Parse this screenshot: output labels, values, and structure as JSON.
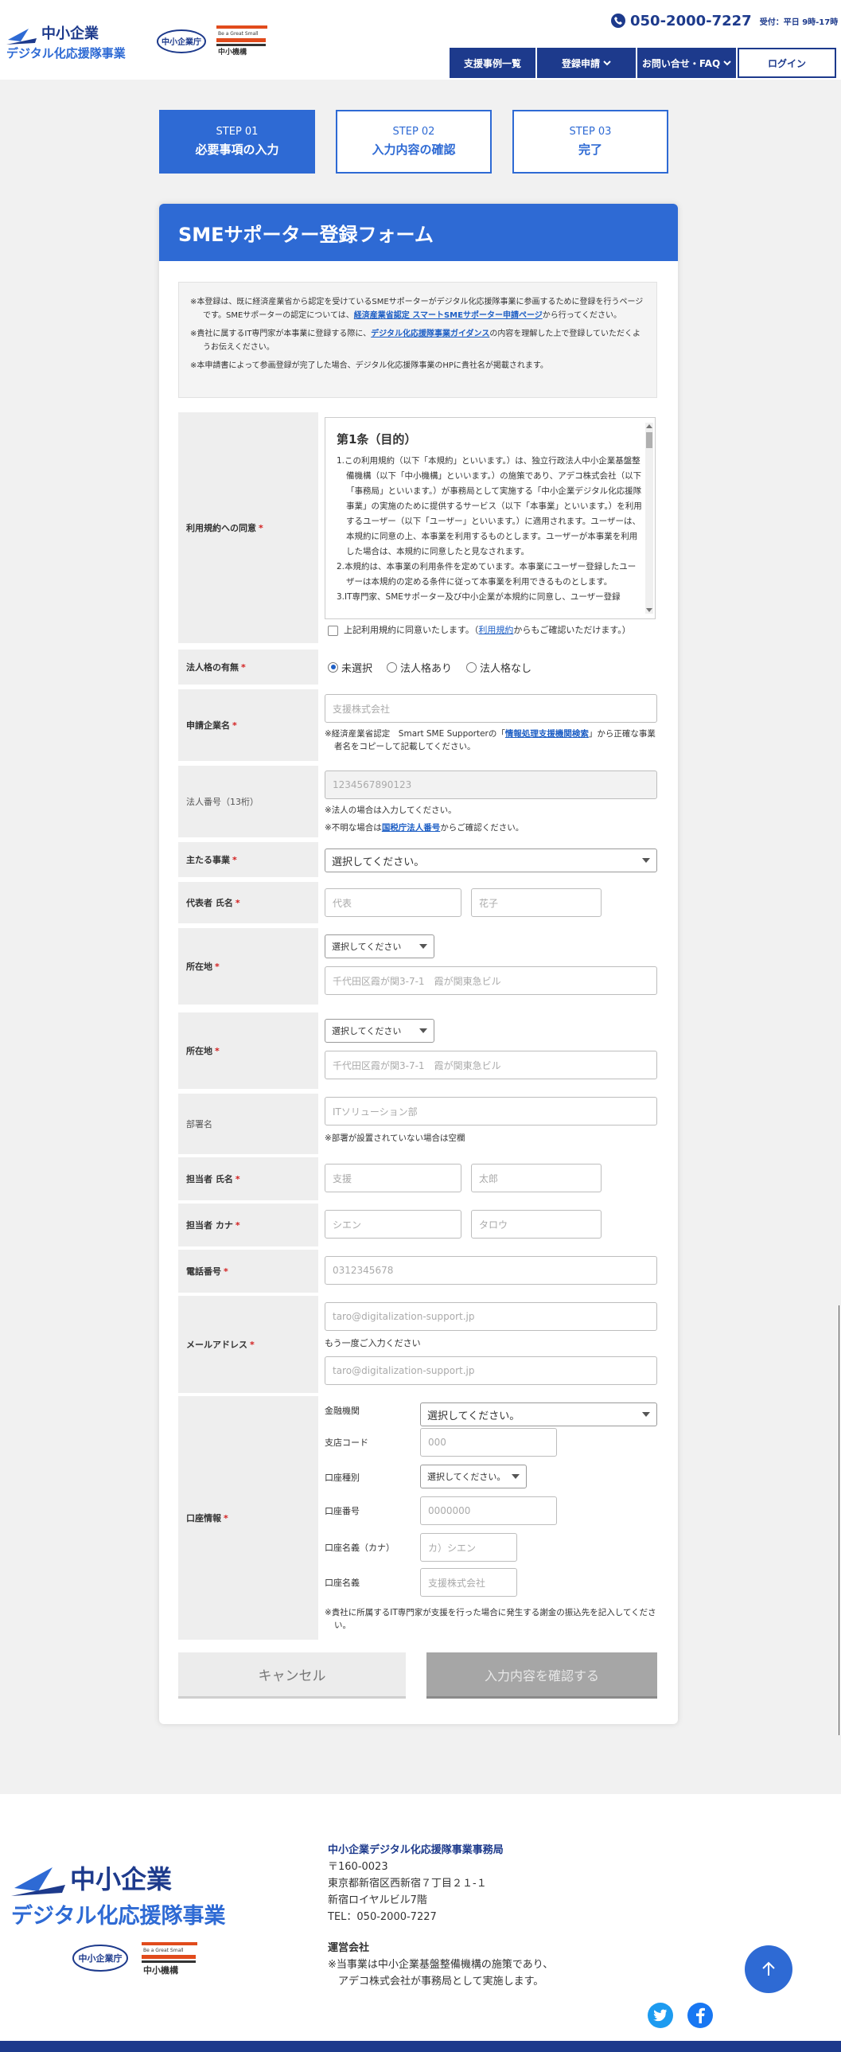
{
  "header": {
    "logo_alt_line1": "中小企業",
    "logo_alt_line2": "デジタル化応援隊事業",
    "phone_number": "050-2000-7227",
    "phone_hours": "受付：平日 9時-17時",
    "nav": [
      {
        "label": "支援事例一覧"
      },
      {
        "label": "登録申請"
      },
      {
        "label": "お問い合せ・FAQ"
      },
      {
        "label": "ログイン"
      }
    ],
    "small_logo_a": "中小企業庁",
    "small_logo_b_top": "Be a Great Small",
    "small_logo_b_bottom": "中小機構"
  },
  "steps": [
    {
      "num": "STEP 01",
      "label": "必要事項の入力"
    },
    {
      "num": "STEP 02",
      "label": "入力内容の確認"
    },
    {
      "num": "STEP 03",
      "label": "完了"
    }
  ],
  "form": {
    "title": "SMEサポーター登録フォーム",
    "notice": {
      "p1_a": "※本登録は、既に経済産業省から認定を受けているSMEサポーターがデジタル化応援隊事業に参画するために登録を行うページです。SMEサポーターの認定については、",
      "p1_link": "経済産業省認定 スマートSMEサポーター申請ページ",
      "p1_b": "から行ってください。",
      "p2_a": "※貴社に属するIT専門家が本事業に登録する際に、",
      "p2_link": "デジタル化応援隊事業ガイダンス",
      "p2_b": "の内容を理解した上で登録していただくようお伝えください。",
      "p3": "※本申請書によって参画登録が完了した場合、デジタル化応援隊事業のHPに貴社名が掲載されます。"
    },
    "required_mark": "*",
    "terms": {
      "label": "利用規約への同意",
      "heading": "第1条（目的）",
      "p1": "1.この利用規約（以下「本規約」といいます。）は、独立行政法人中小企業基盤整備機構（以下「中小機構」といいます。）の施策であり、アデコ株式会社（以下「事務局」といいます。）が事務局として実施する「中小企業デジタル化応援隊事業」の実施のために提供するサービス（以下「本事業」といいます。）を利用するユーザー（以下「ユーザー」といいます。）に適用されます。ユーザーは、本規約に同意の上、本事業を利用するものとします。ユーザーが本事業を利用した場合は、本規約に同意したと見なされます。",
      "p2": "2.本規約は、本事業の利用条件を定めています。本事業にユーザー登録したユーザーは本規約の定める条件に従って本事業を利用できるものとします。",
      "p3": "3.IT専門家、SMEサポーター及び中小企業が本規約に同意し、ユーザー登録",
      "agree_a": "上記利用規約に同意いたします。（",
      "agree_link": "利用規約",
      "agree_b": "からもご確認いただけます。）"
    },
    "corp": {
      "label": "法人格の有無",
      "options": [
        "未選択",
        "法人格あり",
        "法人格なし"
      ],
      "selected": "未選択"
    },
    "company": {
      "label": "申請企業名",
      "placeholder": "支援株式会社",
      "note_a": "※経済産業省認定　Smart SME Supporterの「",
      "note_link": "情報処理支援機関検索",
      "note_b": "」から正確な事業者名をコピーして記載してください。"
    },
    "corp_number": {
      "label": "法人番号（13桁）",
      "placeholder": "1234567890123",
      "note1": "※法人の場合は入力してください。",
      "note2_a": "※不明な場合は",
      "note2_link": "国税庁法人番号",
      "note2_b": "からご確認ください。"
    },
    "business": {
      "label": "主たる事業",
      "value": "選択してください。"
    },
    "rep_name": {
      "label": "代表者 氏名",
      "last": "代表",
      "first": "花子"
    },
    "address1": {
      "label": "所在地",
      "pref": "選択してください",
      "placeholder": "千代田区霞が関3-7-1　霞が関東急ビル"
    },
    "address2": {
      "label": "所在地",
      "pref": "選択してください",
      "placeholder": "千代田区霞が関3-7-1　霞が関東急ビル"
    },
    "department": {
      "label": "部署名",
      "placeholder": "ITソリューション部",
      "note": "※部署が設置されていない場合は空欄"
    },
    "contact_name": {
      "label": "担当者 氏名",
      "last": "支援",
      "first": "太郎"
    },
    "contact_kana": {
      "label": "担当者 カナ",
      "last": "シエン",
      "first": "タロウ"
    },
    "phone": {
      "label": "電話番号",
      "placeholder": "0312345678"
    },
    "email": {
      "label": "メールアドレス",
      "placeholder": "taro@digitalization-support.jp",
      "confirm_label": "もう一度ご入力ください",
      "confirm_placeholder": "taro@digitalization-support.jp"
    },
    "bank": {
      "label": "口座情報",
      "institution_label": "金融機関",
      "institution_value": "選択してください。",
      "branch_label": "支店コード",
      "branch_placeholder": "000",
      "type_label": "口座種別",
      "type_value": "選択してください。",
      "number_label": "口座番号",
      "number_placeholder": "0000000",
      "kana_label": "口座名義（カナ）",
      "kana_placeholder": "カ）シエン",
      "name_label": "口座名義",
      "name_placeholder": "支援株式会社",
      "note": "※貴社に所属するIT専門家が支援を行った場合に発生する謝金の振込先を記入してください。"
    },
    "cancel_label": "キャンセル",
    "confirm_label": "入力内容を確認する"
  },
  "footer": {
    "office": "中小企業デジタル化応援隊事業事務局",
    "zip": "〒160-0023",
    "addr1": "東京都新宿区西新宿７丁目２１-１",
    "addr2": "新宿ロイヤルビル7階",
    "tel": "TEL：050-2000-7227",
    "company_title": "運営会社",
    "company_note1": "※当事業は中小企業基盤整備機構の施策であり、",
    "company_note2": "　アデコ株式会社が事務局として実施します。",
    "logo_line1": "中小企業",
    "logo_line2": "デジタル化応援隊事業",
    "small_logo_a": "中小企業庁",
    "small_logo_b_top": "Be a Great Small",
    "small_logo_b_bottom": "中小機構"
  },
  "colors": {
    "brand": "#1d3a8c",
    "accent": "#2e6ad4",
    "required": "#d21e1e",
    "link": "#1e5fc5"
  }
}
